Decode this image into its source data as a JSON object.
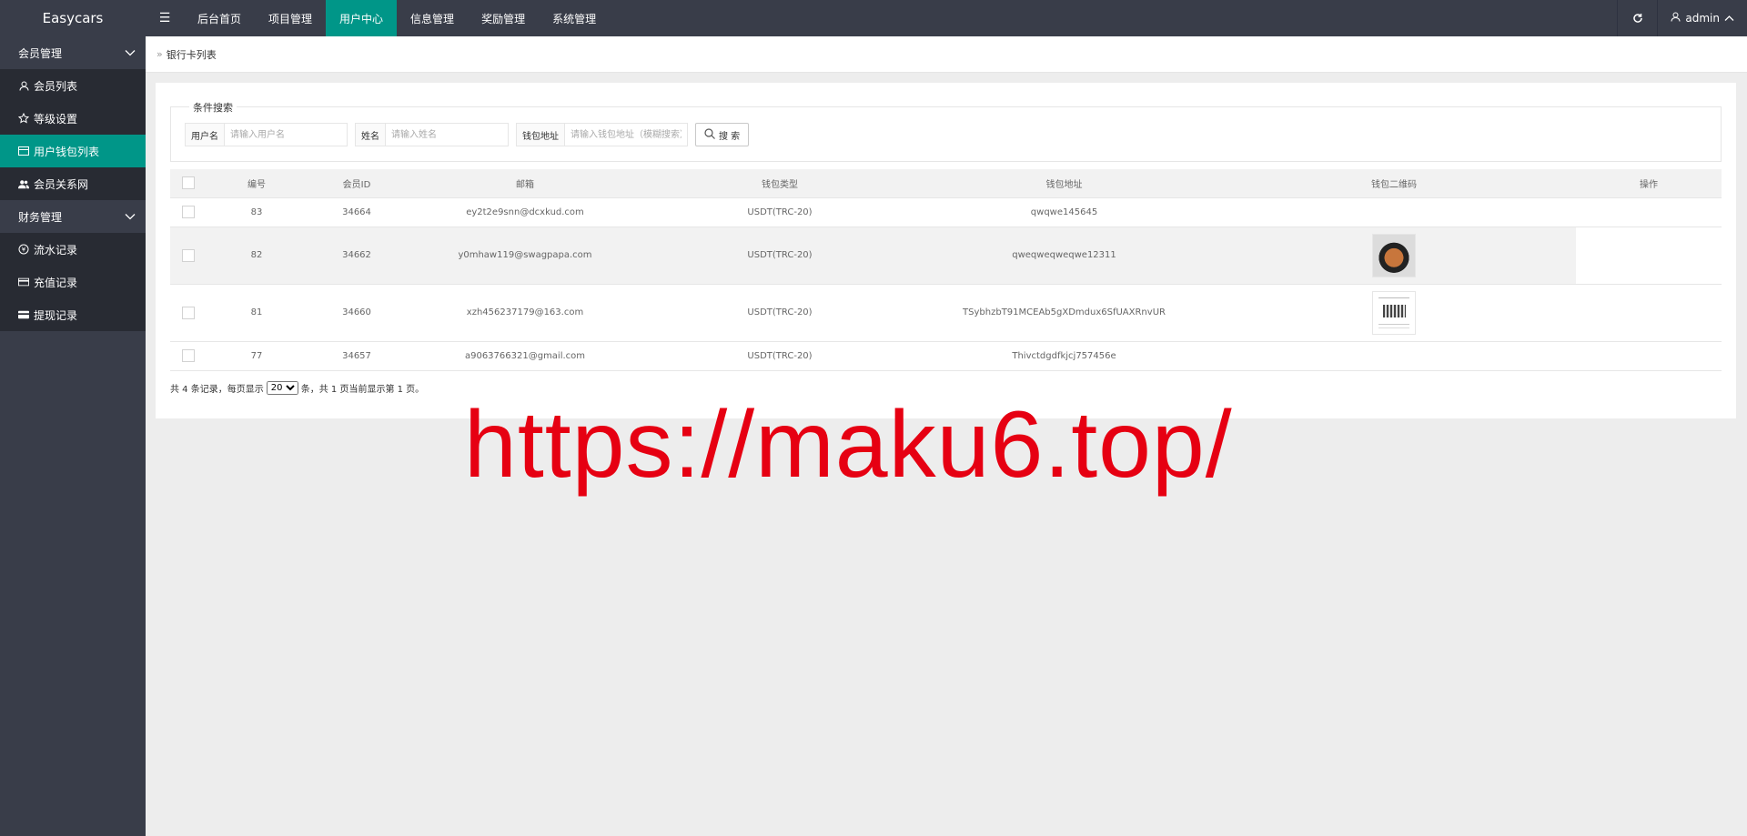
{
  "app": {
    "title": "Easycars"
  },
  "topnav": {
    "menu_icon": "hamburger-icon",
    "items": [
      {
        "label": "后台首页",
        "active": false
      },
      {
        "label": "项目管理",
        "active": false
      },
      {
        "label": "用户中心",
        "active": true
      },
      {
        "label": "信息管理",
        "active": false
      },
      {
        "label": "奖励管理",
        "active": false
      },
      {
        "label": "系统管理",
        "active": false
      }
    ],
    "user": "admin"
  },
  "sidebar": {
    "groups": [
      {
        "label": "会员管理",
        "items": [
          {
            "label": "会员列表",
            "icon": "user-icon"
          },
          {
            "label": "等级设置",
            "icon": "star-icon"
          },
          {
            "label": "用户钱包列表",
            "icon": "card-icon",
            "active": true
          },
          {
            "label": "会员关系网",
            "icon": "users-icon"
          }
        ]
      },
      {
        "label": "财务管理",
        "items": [
          {
            "label": "流水记录",
            "icon": "coin-icon"
          },
          {
            "label": "充值记录",
            "icon": "card-icon"
          },
          {
            "label": "提现记录",
            "icon": "card-icon"
          }
        ]
      }
    ]
  },
  "breadcrumb": {
    "title": "银行卡列表"
  },
  "search": {
    "legend": "条件搜索",
    "fields": [
      {
        "label": "用户名",
        "placeholder": "请输入用户名"
      },
      {
        "label": "姓名",
        "placeholder": "请输入姓名"
      },
      {
        "label": "钱包地址",
        "placeholder": "请输入钱包地址（模糊搜索）"
      }
    ],
    "button_label": "搜 索"
  },
  "table": {
    "headers": [
      "编号",
      "会员ID",
      "邮箱",
      "钱包类型",
      "钱包地址",
      "钱包二维码",
      "操作"
    ],
    "rows": [
      {
        "id": "83",
        "member_id": "34664",
        "email": "ey2t2e9snn@dcxkud.com",
        "wallet_type": "USDT(TRC-20)",
        "address": "qwqwe145645",
        "qr": ""
      },
      {
        "id": "82",
        "member_id": "34662",
        "email": "y0mhaw119@swagpapa.com",
        "wallet_type": "USDT(TRC-20)",
        "address": "qweqweqweqwe12311",
        "qr": "food-image"
      },
      {
        "id": "81",
        "member_id": "34660",
        "email": "xzh456237179@163.com",
        "wallet_type": "USDT(TRC-20)",
        "address": "TSybhzbT91MCEAb5gXDmdux6SfUAXRnvUR",
        "qr": "qr-image"
      },
      {
        "id": "77",
        "member_id": "34657",
        "email": "a9063766321@gmail.com",
        "wallet_type": "USDT(TRC-20)",
        "address": "Thivctdgdfkjcj757456e",
        "qr": ""
      }
    ]
  },
  "pager": {
    "prefix": "共 4 条记录，每页显示",
    "page_size": "20",
    "suffix": "条，共 1 页当前显示第 1 页。"
  },
  "watermark": "https://maku6.top/",
  "colors": {
    "accent": "#009688",
    "topbar": "#393d49",
    "submenu": "#282b33",
    "watermark": "#e60012"
  }
}
